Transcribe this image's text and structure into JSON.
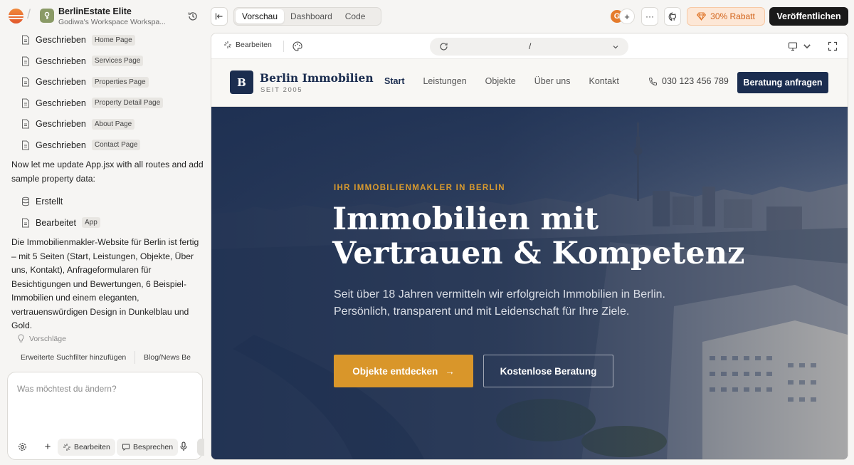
{
  "project": {
    "title": "BerlinEstate Elite",
    "workspace": "Godiwa's Workspace Workspa..."
  },
  "chat": {
    "file_actions": [
      {
        "verb": "Geschrieben",
        "file": "Home Page"
      },
      {
        "verb": "Geschrieben",
        "file": "Services Page"
      },
      {
        "verb": "Geschrieben",
        "file": "Properties Page"
      },
      {
        "verb": "Geschrieben",
        "file": "Property Detail Page"
      },
      {
        "verb": "Geschrieben",
        "file": "About Page"
      },
      {
        "verb": "Geschrieben",
        "file": "Contact Page"
      }
    ],
    "message_1": "Now let me update App.jsx with all routes and add sample property data:",
    "created_label": "Erstellt",
    "edited_label": "Bearbeitet",
    "edited_file": "App",
    "message_2": "Die Immobilienmakler-Website für Berlin ist fertig – mit 5 Seiten (Start, Leistungen, Objekte, Über uns, Kontakt), Anfrageformularen für Besichtigungen und Bewertungen, 6 Beispiel-Immobilien und einem eleganten, vertrauenswürdigen Design in Dunkelblau und Gold."
  },
  "suggestions": {
    "label": "Vorschläge",
    "items": [
      "Erweiterte Suchfilter hinzufügen",
      "Blog/News Be"
    ]
  },
  "composer": {
    "placeholder": "Was möchtest du ändern?",
    "edit_label": "Bearbeiten",
    "discuss_label": "Besprechen"
  },
  "toolbar": {
    "tabs": [
      "Vorschau",
      "Dashboard",
      "Code"
    ],
    "active_tab": "Vorschau",
    "avatar_initial": "G",
    "avatar_plus": "+",
    "more": "···",
    "discount": "30% Rabatt",
    "publish": "Veröffentlichen"
  },
  "preview": {
    "edit_label": "Bearbeiten",
    "url_path": "/"
  },
  "site": {
    "logo_letter": "B",
    "name": "Berlin Immobilien",
    "since": "SEIT 2005",
    "nav": [
      "Start",
      "Leistungen",
      "Objekte",
      "Über uns",
      "Kontakt"
    ],
    "active_nav": "Start",
    "phone": "030 123 456 789",
    "cta": "Beratung anfragen",
    "hero": {
      "eyebrow": "IHR IMMOBILIENMAKLER IN BERLIN",
      "title": "Immobilien mit Vertrauen & Kompetenz",
      "subtitle": "Seit über 18 Jahren vermitteln wir erfolgreich Immobilien in Berlin. Persönlich, transparent und mit Leidenschaft für Ihre Ziele.",
      "primary_button": "Objekte entdecken",
      "primary_arrow": "→",
      "secondary_button": "Kostenlose Beratung"
    }
  },
  "colors": {
    "navy": "#1b2d4f",
    "gold": "#d9962a",
    "publish_bg": "#1a1a1a",
    "discount_text": "#d2641b"
  }
}
